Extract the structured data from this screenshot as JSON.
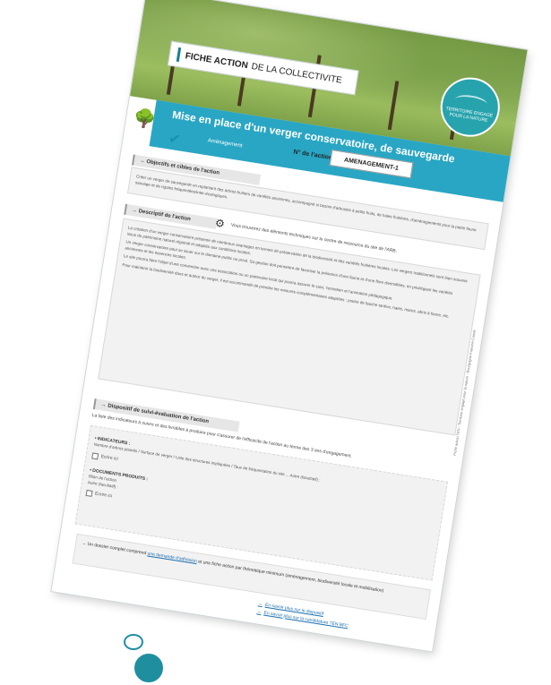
{
  "header": {
    "title_strong": "FICHE ACTION",
    "title_rest": "DE LA COLLECTIVITE",
    "badge_text": "TERRITOIRE ENGAGÉ POUR LA NATURE"
  },
  "banner": {
    "title": "Mise en place d'un verger conservatoire, de sauvegarde",
    "category_label": "Aménagement",
    "action_number_label": "N° de l'action :",
    "action_number_value": "AMENAGEMENT-1"
  },
  "sections": {
    "objectifs": {
      "heading": "→ Objectifs et cibles de l'action",
      "text": "Créer un verger de sauvegarde en replantant des arbres fruitiers de variétés anciennes, accompagné si besoin d'arbustes à petits fruits, de haies fruitières, d'aménagements pour la petite faune sauvage et de rigoles fréquentées/inter-écologiques."
    },
    "descriptif": {
      "heading": "→ Descriptif de l'action",
      "note": "Vous trouverez des éléments techniques sur le centre de ressource du site de l'ARB.",
      "paragraphs": [
        "La création d'un verger conservatoire présente de nombreux avantages en termes de préservation de la biodiversité et des variétés fruitières locales. Les vergers traditionnels sont bien souvent issus du patrimoine naturel régional et adaptés aux conditions locales.",
        "Un verger conservatoire peut se situer sur le domaine public ou privé. Sa gestion doit permettre de favoriser la présence d'une faune et d'une flore diversifiées, en privilégiant les variétés anciennes et les essences locales.",
        "Le site pourra faire l'objet d'une convention avec une association ou un partenaire local qui pourra assurer le suivi, l'entretien et l'animation pédagogique.",
        "Pour maintenir la biodiversité dans et autour du verger, il est recommandé de prendre les mesures complémentaires adaptées : prairie de fauche tardive, haies, mares, abris à faune, etc."
      ]
    },
    "suivi": {
      "heading": "→ Dispositif de suivi-évaluation de l'action",
      "intro": "La liste des indicateurs à suivre et des livrables à produire pour s'assurer de l'efficacité de l'action au terme des 3 ans d'engagement.",
      "indicateurs_label": "• INDICATEURS :",
      "indicateurs_text": "Nombre d'arbres plantés / Surface de verger / Liste des structures impliquées / Taux de fréquentation du site ... Autre (facultatif) :",
      "checkbox_1": "Ecrire ici",
      "documents_label": "• DOCUMENTS PRODUITS :",
      "documents_text_1": "Bilan de l'action",
      "documents_text_2": "Autre (facultatif) :",
      "checkbox_2": "Ecrire ici"
    }
  },
  "footer": {
    "text_before": "→ Un dossier complet comprend ",
    "link_text": "une demande d'adhésion",
    "text_after": " et une fiche action par thématique minimum (aménagement, biodiversité locale et mobilisation)",
    "links": [
      "En savoir plus sur le dispositif",
      "En savoir plus sur la candidature TEN BFC"
    ]
  },
  "side_text": "Fiche action TEN - Territoire engagé pour la nature - Bourgogne-Franche-Comté"
}
